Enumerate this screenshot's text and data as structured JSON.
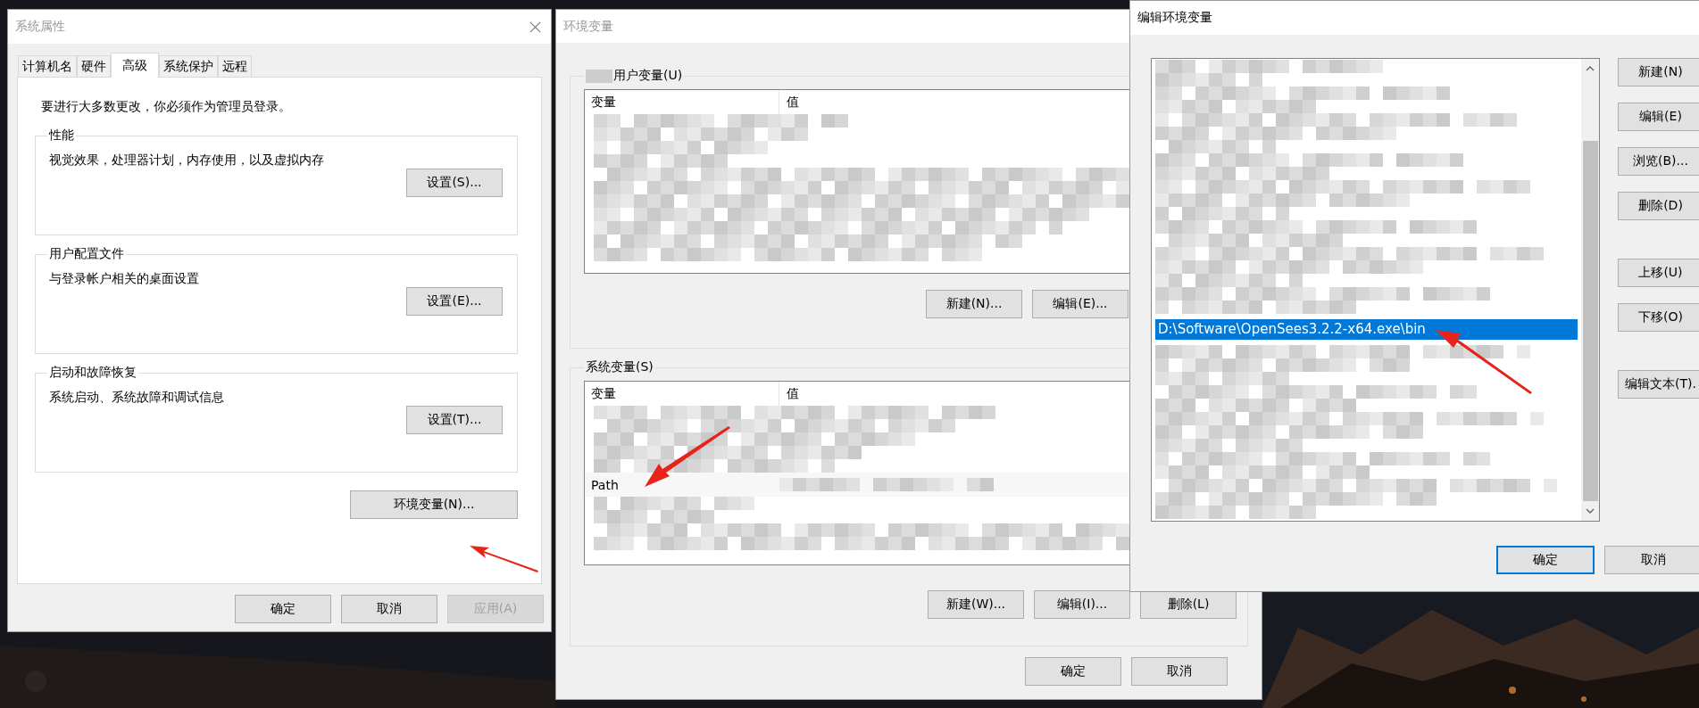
{
  "system_properties": {
    "title": "系统属性",
    "tabs": [
      {
        "label": "计算机名",
        "selected": false
      },
      {
        "label": "硬件",
        "selected": false
      },
      {
        "label": "高级",
        "selected": true
      },
      {
        "label": "系统保护",
        "selected": false
      },
      {
        "label": "远程",
        "selected": false
      }
    ],
    "notice": "要进行大多数更改，你必须作为管理员登录。",
    "groups": [
      {
        "title": "性能",
        "description": "视觉效果，处理器计划，内存使用，以及虚拟内存",
        "button": "设置(S)..."
      },
      {
        "title": "用户配置文件",
        "description": "与登录帐户相关的桌面设置",
        "button": "设置(E)..."
      },
      {
        "title": "启动和故障恢复",
        "description": "系统启动、系统故障和调试信息",
        "button": "设置(T)..."
      }
    ],
    "env_button": "环境变量(N)...",
    "buttons": [
      {
        "label": "确定",
        "disabled": false
      },
      {
        "label": "取消",
        "disabled": false
      },
      {
        "label": "应用(A)",
        "disabled": true
      }
    ]
  },
  "environment_variables": {
    "title": "环境变量",
    "user_group": {
      "title": "用户变量(U)",
      "columns": [
        "变量",
        "值"
      ],
      "buttons": [
        "新建(N)...",
        "编辑(E)..."
      ]
    },
    "system_group": {
      "title": "系统变量(S)",
      "columns": [
        "变量",
        "值"
      ],
      "rows": [
        {
          "name": "Path"
        }
      ],
      "buttons": [
        "新建(W)...",
        "编辑(I)...",
        "删除(L)"
      ]
    },
    "buttons": [
      "确定",
      "取消"
    ]
  },
  "edit_variable": {
    "title": "编辑环境变量",
    "items": [
      {
        "text": "D:\\Software\\OpenSees3.2.2-x64.exe\\bin",
        "selected": true
      }
    ],
    "side_buttons": [
      "新建(N)",
      "编辑(E)",
      "浏览(B)...",
      "删除(D)",
      "上移(U)",
      "下移(O)",
      "编辑文本(T)."
    ],
    "buttons": [
      {
        "label": "确定",
        "default": true
      },
      {
        "label": "取消",
        "default": false
      }
    ]
  }
}
